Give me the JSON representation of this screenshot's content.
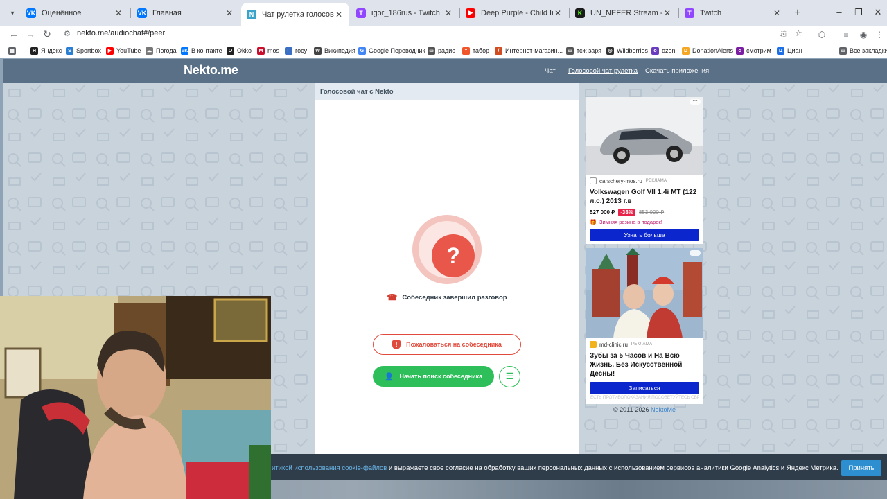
{
  "browser": {
    "tabs": [
      {
        "label": "Оценённое",
        "color": "#0077ff",
        "glyph": "VK"
      },
      {
        "label": "Главная",
        "color": "#0077ff",
        "glyph": "VK"
      },
      {
        "label": "Чат рулетка голосовая — Nek",
        "color": "#3aa3c9",
        "glyph": "N",
        "active": true
      },
      {
        "label": "igor_186rus - Twitch",
        "color": "#9146ff",
        "glyph": "T"
      },
      {
        "label": "Deep Purple - Child In Time - L",
        "color": "#ff0000",
        "glyph": "▶"
      },
      {
        "label": "UN_NEFER Stream - Watch Live",
        "color": "#1a1a1a",
        "glyph": "K"
      },
      {
        "label": "Twitch",
        "color": "#9146ff",
        "glyph": "T"
      }
    ],
    "url": "nekto.me/audiochat#/peer",
    "bookmarks": [
      {
        "label": "Яндекс",
        "color": "#222"
      },
      {
        "label": "Sportbox",
        "color": "#2a7fd4"
      },
      {
        "label": "YouTube",
        "color": "#ff0000"
      },
      {
        "label": "Погода",
        "color": "#777"
      },
      {
        "label": "В контакте",
        "color": "#0077ff"
      },
      {
        "label": "Okko",
        "color": "#222"
      },
      {
        "label": "mos",
        "color": "#c8102e"
      },
      {
        "label": "госу",
        "color": "#3a6fc4"
      },
      {
        "label": "Википедия",
        "color": "#444"
      },
      {
        "label": "Google Переводчик",
        "color": "#4285f4"
      },
      {
        "label": "радио",
        "color": "#555"
      },
      {
        "label": "табор",
        "color": "#f0562a"
      },
      {
        "label": "Интернет-магазин...",
        "color": "#d04d22"
      },
      {
        "label": "тсж заря",
        "color": "#555"
      },
      {
        "label": "Wildberries",
        "color": "#333"
      },
      {
        "label": "ozon",
        "color": "#6a3dbf"
      },
      {
        "label": "DonationAlerts",
        "color": "#f5a623"
      },
      {
        "label": "смотрим",
        "color": "#7b1fa2"
      },
      {
        "label": "Циан",
        "color": "#1e6fe6"
      }
    ],
    "all_bookmarks": "Все закладки"
  },
  "site": {
    "logo": "Nekto.me",
    "nav": [
      "Чат",
      "Голосовой чат рулетка",
      "Скачать приложения"
    ]
  },
  "chat": {
    "header": "Голосовой чат с Nekto",
    "question_mark": "?",
    "status": "Собеседник завершил разговор",
    "report_label": "Пожаловаться на собеседника",
    "search_label": "Начать поиск собеседника"
  },
  "ads": [
    {
      "source": "carschery-mos.ru",
      "tag": "РЕКЛАМА",
      "title": "Volkswagen Golf VII 1.4i MT (122 л.с.) 2013 г.в",
      "price": "527 000 ₽",
      "discount": "-38%",
      "old_price": "853 000 ₽",
      "promo": "Зимняя резина в подарок!",
      "cta": "Узнать больше"
    },
    {
      "source": "md-clinic.ru",
      "tag": "РЕКЛАМА",
      "title": "Зубы за 5 Часов и На Всю Жизнь. Без Искусственной Десны!",
      "cta": "Записаться",
      "warning": "ЕСТЬ ПРОТИВОПОКАЗАНИЯ ПОСОВЕТУЙТЕСЬ СВРАЧОМ"
    }
  ],
  "footer": {
    "copyright": "© 2011-2026 ",
    "brand_link": "NektoMe"
  },
  "cookie": {
    "link_text": "итикой использования cookie-файлов",
    "text": " и выражаете свое согласие на обработку ваших персональных данных с использованием сервисов аналитики Google Analytics и Яндекс Метрика.",
    "accept": "Принять"
  },
  "colors": {
    "header_bg": "#5a7086",
    "accent_red": "#e04a3c",
    "accent_green": "#2fbf5a",
    "ad_cta": "#0a26cc"
  }
}
